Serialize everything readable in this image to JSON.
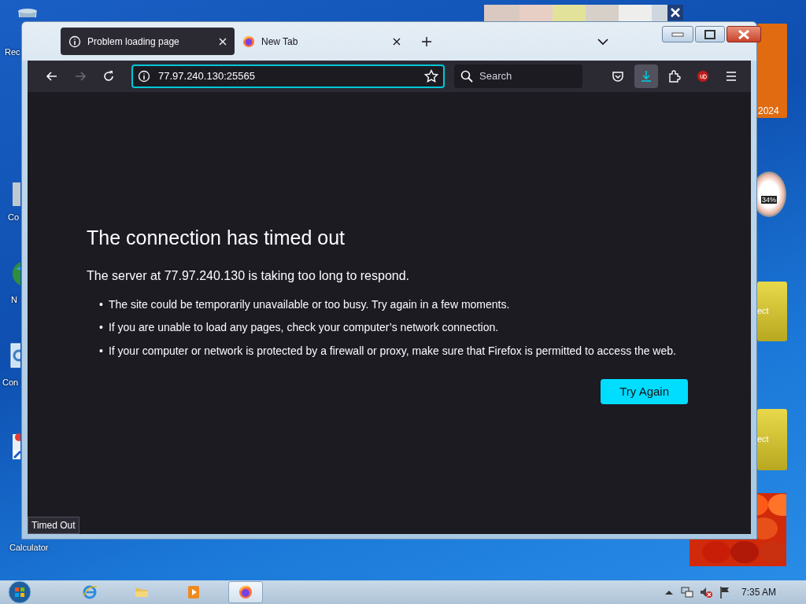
{
  "desktop": {
    "icons": [
      {
        "label": "Rec",
        "kind": "bin"
      },
      {
        "label": "Co",
        "kind": "computer"
      },
      {
        "label": "N",
        "kind": "globe"
      },
      {
        "label": "Con",
        "kind": "panel"
      },
      {
        "label": "Calculator",
        "kind": "shortcut"
      }
    ],
    "gadgets": [
      {
        "kind": "calendar",
        "text": "2024"
      },
      {
        "kind": "meter",
        "text": "34%"
      },
      {
        "kind": "tile",
        "text": "ect"
      },
      {
        "kind": "tile",
        "text": "ect"
      },
      {
        "kind": "picture"
      }
    ]
  },
  "browser": {
    "tabs": [
      {
        "title": "Problem loading page",
        "kind": "info",
        "selected": true
      },
      {
        "title": "New Tab",
        "kind": "firefox",
        "selected": false
      }
    ],
    "url": "77.97.240.130:25565",
    "search": {
      "placeholder": "Search"
    },
    "error": {
      "title": "The connection has timed out",
      "subtitle": "The server at 77.97.240.130 is taking too long to respond.",
      "bullet_marker": "•",
      "bullets": [
        "The site could be temporarily unavailable or too busy. Try again in a few moments.",
        "If you are unable to load any pages, check your computer’s network connection.",
        "If your computer or network is protected by a firewall or proxy, make sure that Firefox is permitted to access the web."
      ],
      "button": "Try Again"
    },
    "status": "Timed Out"
  },
  "taskbar": {
    "apps": [
      {
        "kind": "ie",
        "selected": false
      },
      {
        "kind": "folder",
        "selected": false
      },
      {
        "kind": "media",
        "selected": false
      },
      {
        "kind": "firefox",
        "selected": true
      }
    ],
    "clock": "7:35 AM"
  }
}
